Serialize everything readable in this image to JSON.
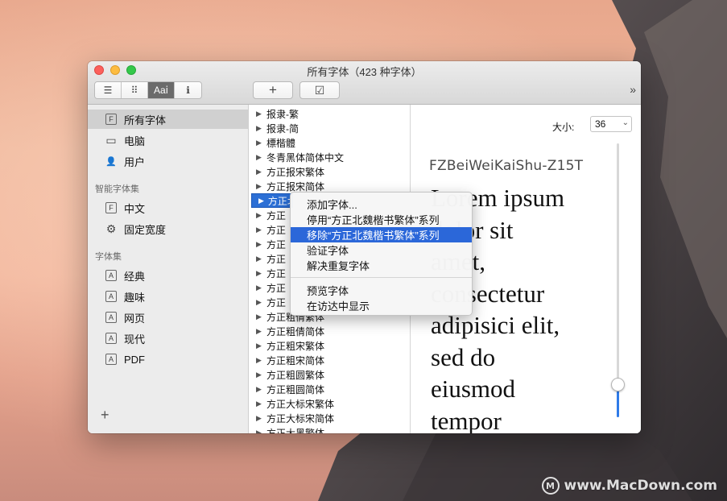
{
  "window": {
    "title": "所有字体（423 种字体）"
  },
  "toolbar": {
    "view_buttons": [
      {
        "icon": "list-lines-icon",
        "glyph": "☰"
      },
      {
        "icon": "grid-icon",
        "glyph": "⠿"
      },
      {
        "icon": "text-preview-icon",
        "glyph": "Aaⅰ"
      },
      {
        "icon": "info-icon",
        "glyph": "ℹ"
      }
    ],
    "add_glyph": "+",
    "validate_glyph": "☑",
    "overflow_glyph": "»"
  },
  "sidebar": {
    "items": [
      {
        "label": "所有字体",
        "icon": "F"
      },
      {
        "label": "电脑",
        "icon": "▭"
      },
      {
        "label": "用户",
        "icon": "👤"
      }
    ],
    "smart_header": "智能字体集",
    "smart_items": [
      {
        "label": "中文",
        "icon": "F"
      },
      {
        "label": "固定宽度",
        "icon": "⚙"
      }
    ],
    "collections_header": "字体集",
    "collections": [
      {
        "label": "经典",
        "icon": "A"
      },
      {
        "label": "趣味",
        "icon": "A"
      },
      {
        "label": "网页",
        "icon": "A"
      },
      {
        "label": "现代",
        "icon": "A"
      },
      {
        "label": "PDF",
        "icon": "A"
      }
    ],
    "add_glyph": "+"
  },
  "font_list": [
    "报隶-繁",
    "报隶-简",
    "標楷體",
    "冬青黑体简体中文",
    "方正报宋繁体",
    "方正报宋简体",
    "方正北魏楷书繁体",
    "方正",
    "方正",
    "方正",
    "方正",
    "方正",
    "方正",
    "方正",
    "方正粗倩繁体",
    "方正粗倩简体",
    "方正粗宋繁体",
    "方正粗宋简体",
    "方正粗圆繁体",
    "方正粗圆简体",
    "方正大标宋繁体",
    "方正大标宋简体",
    "方正大黑繁体"
  ],
  "preview": {
    "size_label": "大小:",
    "size_value": "36",
    "font_name": "FZBeiWeiKaiShu-Z15T",
    "sample_lines": [
      "Lorem ipsum",
      "dolor sit",
      "amet,",
      "consectetur",
      "adipisici elit,",
      "sed do",
      "eiusmod",
      "tempor"
    ],
    "slider_level": 0.12
  },
  "context_menu": {
    "items": [
      "添加字体...",
      "停用“方正北魏楷书繁体”系列",
      "移除“方正北魏楷书繁体”系列",
      "验证字体",
      "解决重复字体",
      "预览字体",
      "在访达中显示"
    ],
    "highlighted_index": 2
  },
  "watermark": "www.MacDown.com"
}
